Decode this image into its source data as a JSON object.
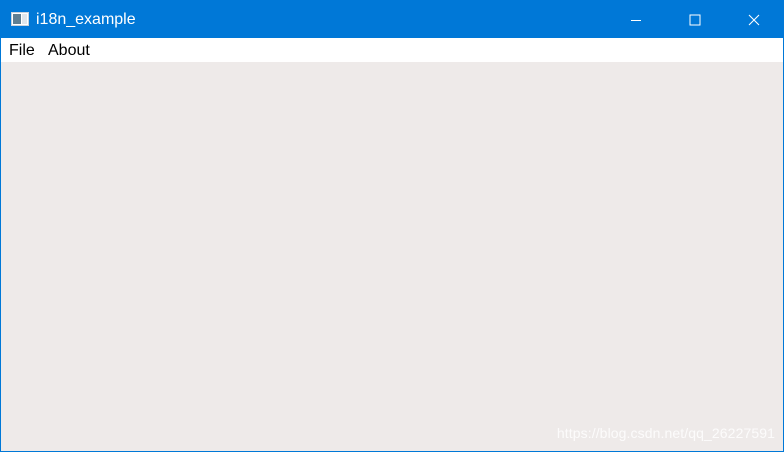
{
  "window": {
    "title": "i18n_example",
    "accent_color": "#0078d7",
    "client_color": "#eeeae9",
    "icon": "app-window-icon"
  },
  "caption_buttons": {
    "minimize_icon": "minimize-icon",
    "maximize_icon": "maximize-icon",
    "close_icon": "close-icon"
  },
  "menubar": {
    "items": [
      {
        "label": "File"
      },
      {
        "label": "About"
      }
    ]
  },
  "watermark": {
    "text": "https://blog.csdn.net/qq_26227591"
  }
}
